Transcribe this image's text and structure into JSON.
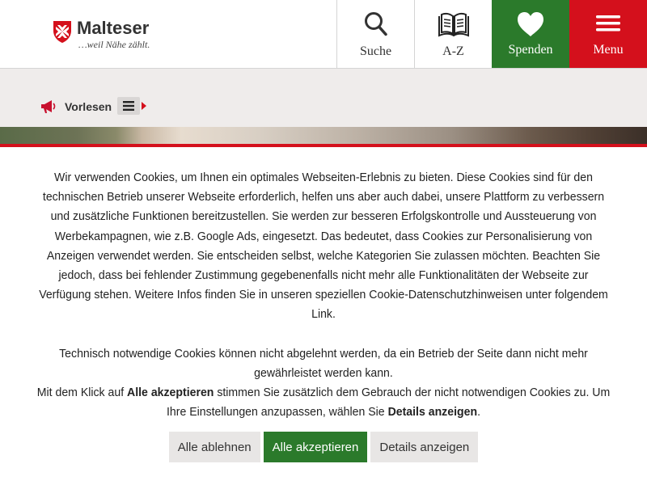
{
  "brand": {
    "name": "Malteser",
    "tagline": "…weil Nähe zählt."
  },
  "header": {
    "search_label": "Suche",
    "az_label": "A-Z",
    "donate_label": "Spenden",
    "menu_label": "Menu"
  },
  "readspeaker": {
    "read_label": "Vorlesen"
  },
  "colors": {
    "brand_red": "#d4101c",
    "brand_green": "#2b7a2b"
  },
  "cookie": {
    "intro": "Wir verwenden Cookies, um Ihnen ein optimales Webseiten-Erlebnis zu bieten. Diese Cookies sind für den technischen Betrieb unserer Webseite erforderlich, helfen uns aber auch dabei, unsere Plattform zu verbessern und zusätzliche Funktionen bereitzustellen. Sie werden zur besseren Erfolgskontrolle und Aussteuerung von Werbekampagnen, wie z.B. Google Ads, eingesetzt. Das bedeutet, dass Cookies zur Personalisierung von Anzeigen verwendet werden. Sie entscheiden selbst, welche Kategorien Sie zulassen möchten. Beachten Sie jedoch, dass bei fehlender Zustimmung gegebenenfalls nicht mehr alle Funktionalitäten der Webseite zur Verfügung stehen. Weitere Infos finden Sie in unseren speziellen Cookie-Datenschutzhinweisen unter folgendem Link.",
    "necessary": "Technisch notwendige Cookies können nicht abgelehnt werden, da ein Betrieb der Seite dann nicht mehr gewährleistet werden kann.",
    "click_prefix": "Mit dem Klick auf",
    "accept_all_inline": "Alle akzeptieren",
    "click_middle": "stimmen Sie zusätzlich dem Gebrauch der nicht notwendigen Cookies zu. Um Ihre Einstellungen anzupassen, wählen Sie",
    "details_inline": "Details anzeigen",
    "click_suffix": ".",
    "buttons": {
      "reject": "Alle ablehnen",
      "accept": "Alle akzeptieren",
      "details": "Details anzeigen"
    }
  }
}
